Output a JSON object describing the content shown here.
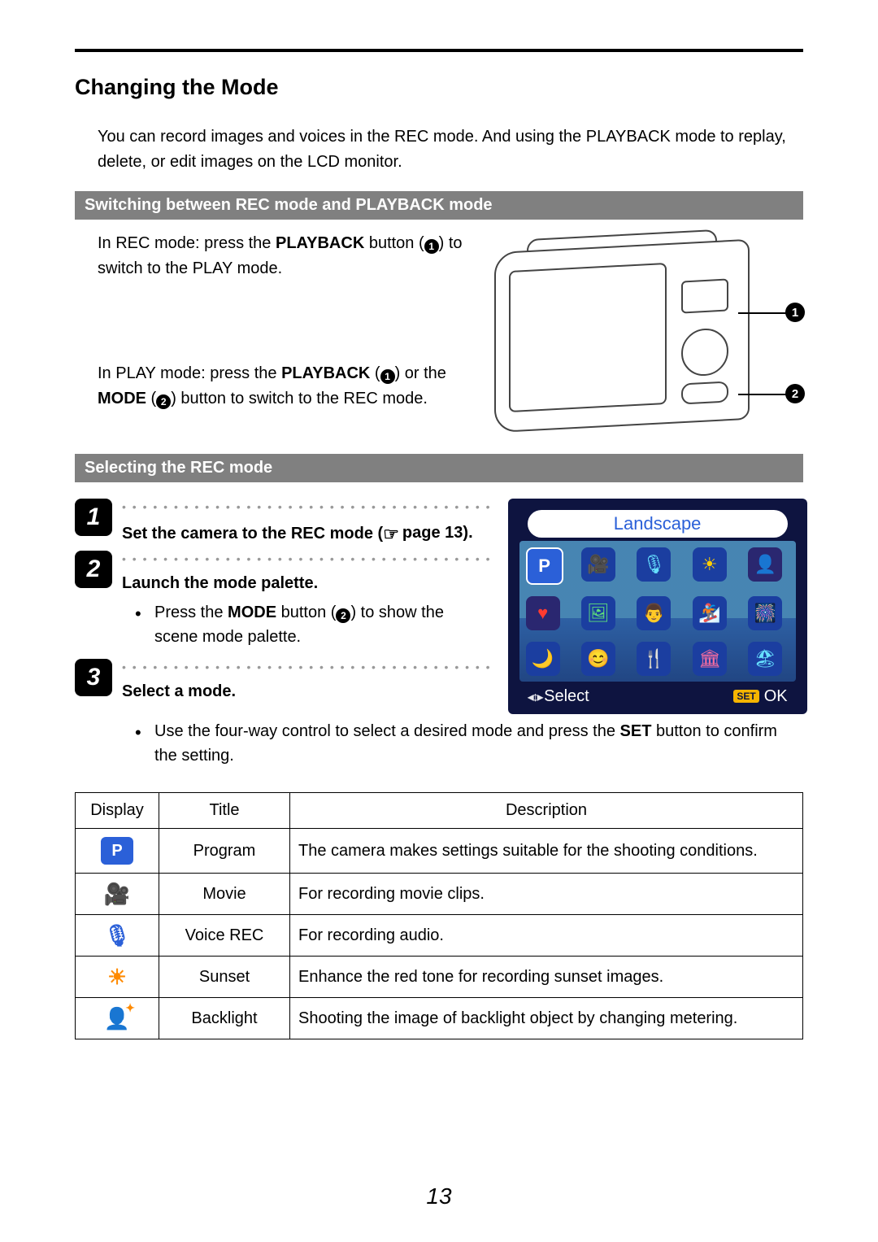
{
  "heading": "Changing the Mode",
  "intro": "You can record images and voices in the REC mode. And using the PLAYBACK mode to replay, delete, or edit images on the LCD monitor.",
  "sub1": "Switching between REC mode and PLAYBACK mode",
  "rec_to_play_pre": "In REC mode: press the ",
  "rec_to_play_bold": "PLAYBACK",
  "rec_to_play_post": " button (",
  "rec_to_play_tail": ") to switch to the PLAY mode.",
  "play_to_rec_pre": "In PLAY mode: press the ",
  "play_to_rec_b1": "PLAYBACK",
  "play_to_rec_mid1": " (",
  "play_to_rec_mid2": ") or the ",
  "play_to_rec_b2": "MODE",
  "play_to_rec_mid3": " (",
  "play_to_rec_tail": ") button to switch to the REC mode.",
  "callout1": "1",
  "callout2": "2",
  "sub2": "Selecting the REC mode",
  "steps": {
    "s1": {
      "num": "1",
      "title": "Set the camera to the REC mode (",
      "page_ref": "page 13).",
      "dots": "• • • • • • • • • • • • • • • • • • • • • • • • • • • • • • • • • • • •"
    },
    "s2": {
      "num": "2",
      "title": "Launch the mode palette.",
      "bullet_pre": "Press the ",
      "bullet_bold": "MODE",
      "bullet_mid": " button (",
      "bullet_tail": ") to show the scene mode palette.",
      "dots": "• • • • • • • • • • • • • • • • • • • • • • • • • • • • • • • • • • • •"
    },
    "s3": {
      "num": "3",
      "title": "Select a mode.",
      "bullet_pre": "Use the four-way control to select a desired mode and press the ",
      "bullet_bold": "SET",
      "bullet_tail": " button to confirm the setting.",
      "dots": "• • • • • • • • • • • • • • • • • • • • • • • • • • • • • • • • • • • •"
    }
  },
  "lcd": {
    "title": "Landscape",
    "select": "Select",
    "set_label": "SET",
    "ok": "OK",
    "icons": [
      "P",
      "🎥",
      "🎙",
      "☀",
      "👤",
      "♥",
      "🖼",
      "👨",
      "🏂",
      "🎆",
      "🌙",
      "😊",
      "🍴",
      "🏛",
      "🏖"
    ]
  },
  "table": {
    "headers": {
      "display": "Display",
      "title": "Title",
      "desc": "Description"
    },
    "rows": [
      {
        "icon": "P",
        "cls": "ico-p",
        "title": "Program",
        "desc": "The camera makes settings suitable for the shooting conditions."
      },
      {
        "icon": "🎥",
        "cls": "ico-movie",
        "title": "Movie",
        "desc": "For recording movie clips."
      },
      {
        "icon": "🎙",
        "cls": "ico-mic",
        "title": "Voice REC",
        "desc": "For recording audio."
      },
      {
        "icon": "☀",
        "cls": "ico-sunset",
        "title": "Sunset",
        "desc": "Enhance the red tone for recording sunset images."
      },
      {
        "icon": "👤",
        "cls": "ico-backlight",
        "title": "Backlight",
        "desc": "Shooting the image of backlight object by changing metering."
      }
    ]
  },
  "page_number": "13"
}
